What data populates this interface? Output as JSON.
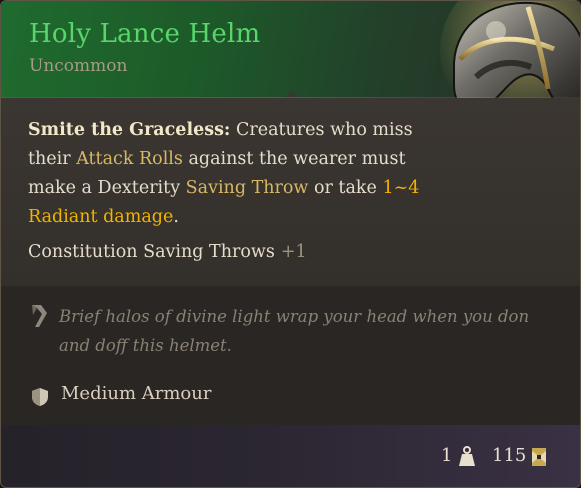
{
  "item": {
    "name": "Holy Lance Helm",
    "rarity": "Uncommon",
    "rarity_color": "#a79a86",
    "name_color": "#58d66c"
  },
  "description": {
    "title": "Smite the Graceless:",
    "seg1": " Creatures who miss their ",
    "kw_attack": "Attack Rolls",
    "seg2": " against the wearer must make a Dexterity ",
    "kw_saving": "Saving Throw",
    "seg3": " or take ",
    "kw_damage": "1~4 Radiant damage",
    "seg4": "."
  },
  "bonus": {
    "label": "Constitution Saving Throws",
    "value": "+1"
  },
  "flavor": {
    "icon": "quill-icon",
    "text": "Brief halos of divine light wrap your head when you don and doff this helmet."
  },
  "armour": {
    "icon": "shield-icon",
    "label": "Medium Armour"
  },
  "footer": {
    "weight": "1",
    "weight_icon": "weight-icon",
    "value": "115",
    "value_icon": "gold-coin-icon"
  },
  "colors": {
    "keyword": "#d9b865",
    "damage": "#f2b400",
    "text": "#e6dccb",
    "muted": "#9e9382"
  }
}
